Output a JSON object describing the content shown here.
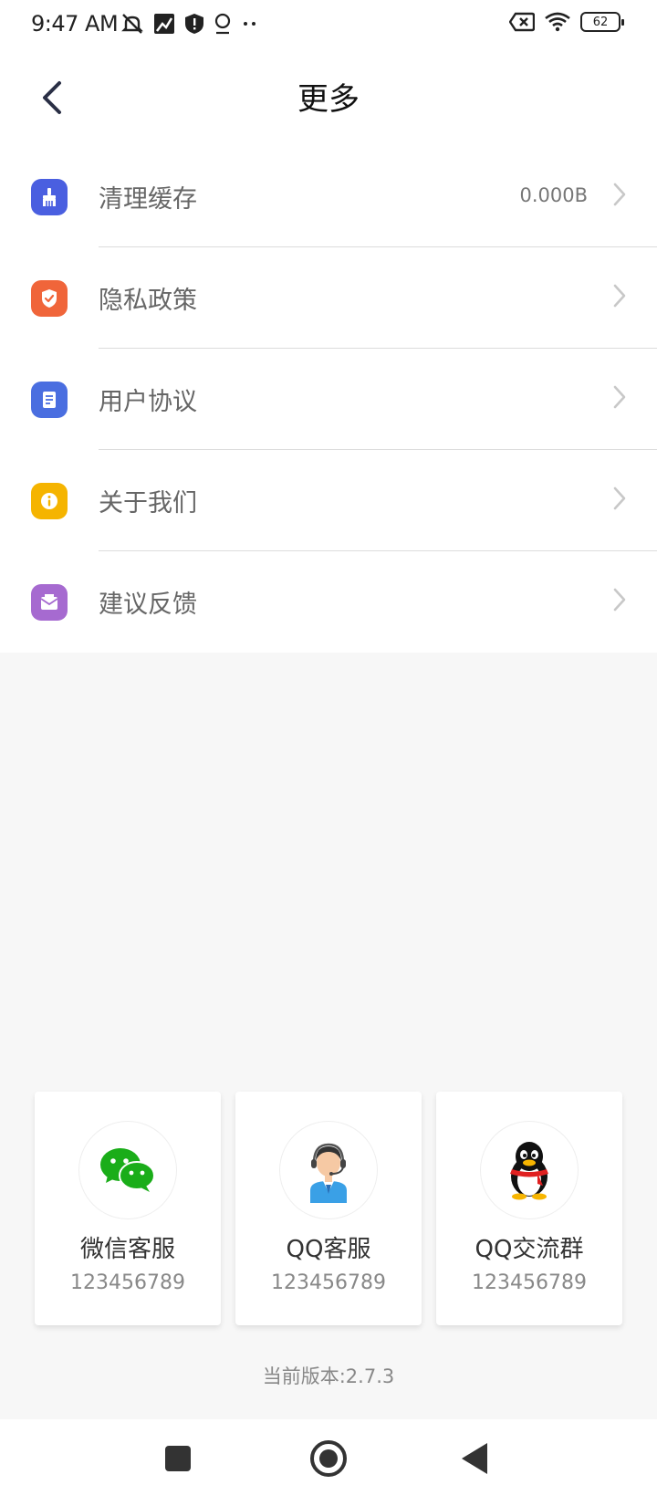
{
  "status_bar": {
    "time": "9:47 AM",
    "battery": "62"
  },
  "header": {
    "title": "更多"
  },
  "menu": {
    "items": [
      {
        "label": "清理缓存",
        "value": "0.000B",
        "icon": "broom-icon",
        "color": "#4a5fe0"
      },
      {
        "label": "隐私政策",
        "value": "",
        "icon": "shield-check-icon",
        "color": "#f0653a"
      },
      {
        "label": "用户协议",
        "value": "",
        "icon": "document-icon",
        "color": "#4a6ee0"
      },
      {
        "label": "关于我们",
        "value": "",
        "icon": "info-icon",
        "color": "#f5b400"
      },
      {
        "label": "建议反馈",
        "value": "",
        "icon": "mail-icon",
        "color": "#a66ad0"
      }
    ]
  },
  "contacts": [
    {
      "name": "微信客服",
      "number": "123456789",
      "icon": "wechat-icon"
    },
    {
      "name": "QQ客服",
      "number": "123456789",
      "icon": "customer-service-agent-icon"
    },
    {
      "name": "QQ交流群",
      "number": "123456789",
      "icon": "qq-penguin-icon"
    }
  ],
  "version": "当前版本:2.7.3"
}
